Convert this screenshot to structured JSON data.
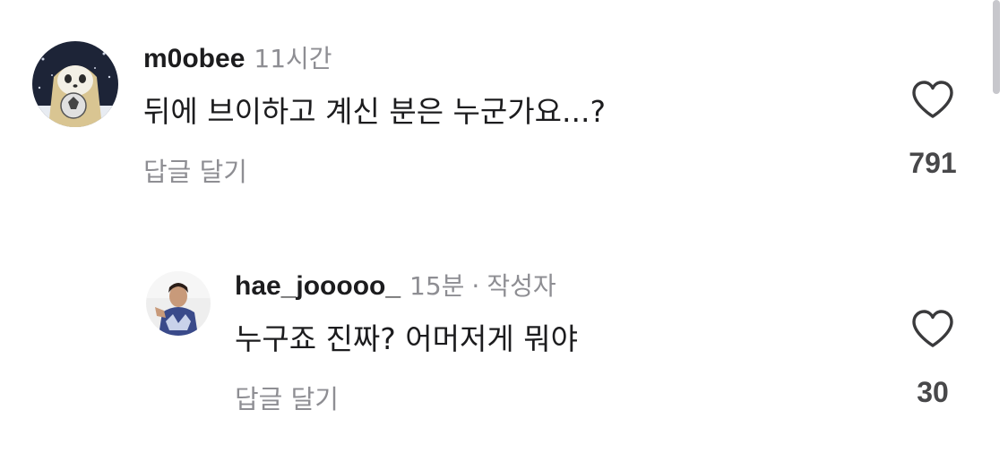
{
  "comments": [
    {
      "username": "m0obee",
      "time": "11시간",
      "text": "뒤에 브이하고 계신 분은 누군가요...?",
      "reply_label": "답글 달기",
      "likes": "791",
      "like_icon": "heart-icon"
    }
  ],
  "replies": [
    {
      "username": "hae_jooooo_",
      "time": "15분",
      "separator": "·",
      "author_tag": "작성자",
      "text": "누구죠 진짜? 어머저게 뭐야",
      "reply_label": "답글 달기",
      "likes": "30",
      "like_icon": "heart-icon"
    }
  ]
}
